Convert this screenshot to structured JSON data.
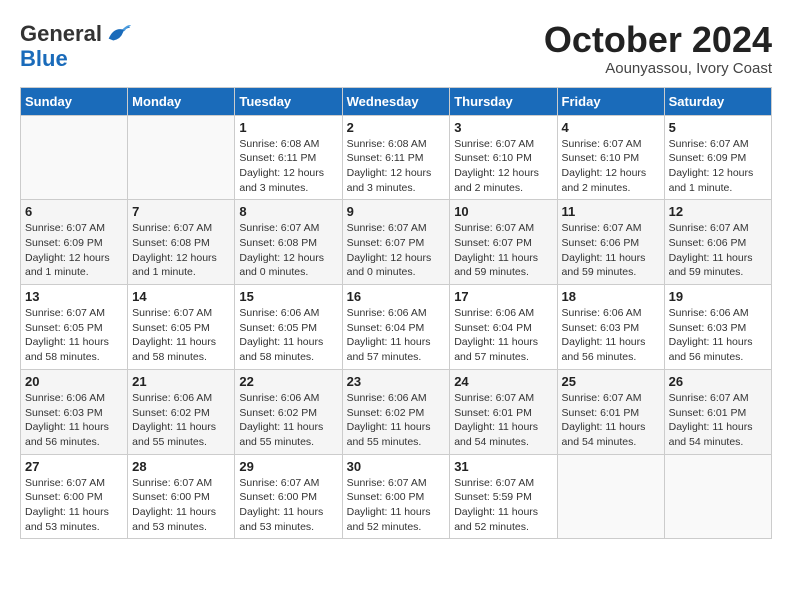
{
  "logo": {
    "text_general": "General",
    "text_blue": "Blue"
  },
  "header": {
    "month_title": "October 2024",
    "subtitle": "Aounyassou, Ivory Coast"
  },
  "days_of_week": [
    "Sunday",
    "Monday",
    "Tuesday",
    "Wednesday",
    "Thursday",
    "Friday",
    "Saturday"
  ],
  "weeks": [
    [
      {
        "day": "",
        "info": ""
      },
      {
        "day": "",
        "info": ""
      },
      {
        "day": "1",
        "info": "Sunrise: 6:08 AM\nSunset: 6:11 PM\nDaylight: 12 hours and 3 minutes."
      },
      {
        "day": "2",
        "info": "Sunrise: 6:08 AM\nSunset: 6:11 PM\nDaylight: 12 hours and 3 minutes."
      },
      {
        "day": "3",
        "info": "Sunrise: 6:07 AM\nSunset: 6:10 PM\nDaylight: 12 hours and 2 minutes."
      },
      {
        "day": "4",
        "info": "Sunrise: 6:07 AM\nSunset: 6:10 PM\nDaylight: 12 hours and 2 minutes."
      },
      {
        "day": "5",
        "info": "Sunrise: 6:07 AM\nSunset: 6:09 PM\nDaylight: 12 hours and 1 minute."
      }
    ],
    [
      {
        "day": "6",
        "info": "Sunrise: 6:07 AM\nSunset: 6:09 PM\nDaylight: 12 hours and 1 minute."
      },
      {
        "day": "7",
        "info": "Sunrise: 6:07 AM\nSunset: 6:08 PM\nDaylight: 12 hours and 1 minute."
      },
      {
        "day": "8",
        "info": "Sunrise: 6:07 AM\nSunset: 6:08 PM\nDaylight: 12 hours and 0 minutes."
      },
      {
        "day": "9",
        "info": "Sunrise: 6:07 AM\nSunset: 6:07 PM\nDaylight: 12 hours and 0 minutes."
      },
      {
        "day": "10",
        "info": "Sunrise: 6:07 AM\nSunset: 6:07 PM\nDaylight: 11 hours and 59 minutes."
      },
      {
        "day": "11",
        "info": "Sunrise: 6:07 AM\nSunset: 6:06 PM\nDaylight: 11 hours and 59 minutes."
      },
      {
        "day": "12",
        "info": "Sunrise: 6:07 AM\nSunset: 6:06 PM\nDaylight: 11 hours and 59 minutes."
      }
    ],
    [
      {
        "day": "13",
        "info": "Sunrise: 6:07 AM\nSunset: 6:05 PM\nDaylight: 11 hours and 58 minutes."
      },
      {
        "day": "14",
        "info": "Sunrise: 6:07 AM\nSunset: 6:05 PM\nDaylight: 11 hours and 58 minutes."
      },
      {
        "day": "15",
        "info": "Sunrise: 6:06 AM\nSunset: 6:05 PM\nDaylight: 11 hours and 58 minutes."
      },
      {
        "day": "16",
        "info": "Sunrise: 6:06 AM\nSunset: 6:04 PM\nDaylight: 11 hours and 57 minutes."
      },
      {
        "day": "17",
        "info": "Sunrise: 6:06 AM\nSunset: 6:04 PM\nDaylight: 11 hours and 57 minutes."
      },
      {
        "day": "18",
        "info": "Sunrise: 6:06 AM\nSunset: 6:03 PM\nDaylight: 11 hours and 56 minutes."
      },
      {
        "day": "19",
        "info": "Sunrise: 6:06 AM\nSunset: 6:03 PM\nDaylight: 11 hours and 56 minutes."
      }
    ],
    [
      {
        "day": "20",
        "info": "Sunrise: 6:06 AM\nSunset: 6:03 PM\nDaylight: 11 hours and 56 minutes."
      },
      {
        "day": "21",
        "info": "Sunrise: 6:06 AM\nSunset: 6:02 PM\nDaylight: 11 hours and 55 minutes."
      },
      {
        "day": "22",
        "info": "Sunrise: 6:06 AM\nSunset: 6:02 PM\nDaylight: 11 hours and 55 minutes."
      },
      {
        "day": "23",
        "info": "Sunrise: 6:06 AM\nSunset: 6:02 PM\nDaylight: 11 hours and 55 minutes."
      },
      {
        "day": "24",
        "info": "Sunrise: 6:07 AM\nSunset: 6:01 PM\nDaylight: 11 hours and 54 minutes."
      },
      {
        "day": "25",
        "info": "Sunrise: 6:07 AM\nSunset: 6:01 PM\nDaylight: 11 hours and 54 minutes."
      },
      {
        "day": "26",
        "info": "Sunrise: 6:07 AM\nSunset: 6:01 PM\nDaylight: 11 hours and 54 minutes."
      }
    ],
    [
      {
        "day": "27",
        "info": "Sunrise: 6:07 AM\nSunset: 6:00 PM\nDaylight: 11 hours and 53 minutes."
      },
      {
        "day": "28",
        "info": "Sunrise: 6:07 AM\nSunset: 6:00 PM\nDaylight: 11 hours and 53 minutes."
      },
      {
        "day": "29",
        "info": "Sunrise: 6:07 AM\nSunset: 6:00 PM\nDaylight: 11 hours and 53 minutes."
      },
      {
        "day": "30",
        "info": "Sunrise: 6:07 AM\nSunset: 6:00 PM\nDaylight: 11 hours and 52 minutes."
      },
      {
        "day": "31",
        "info": "Sunrise: 6:07 AM\nSunset: 5:59 PM\nDaylight: 11 hours and 52 minutes."
      },
      {
        "day": "",
        "info": ""
      },
      {
        "day": "",
        "info": ""
      }
    ]
  ]
}
